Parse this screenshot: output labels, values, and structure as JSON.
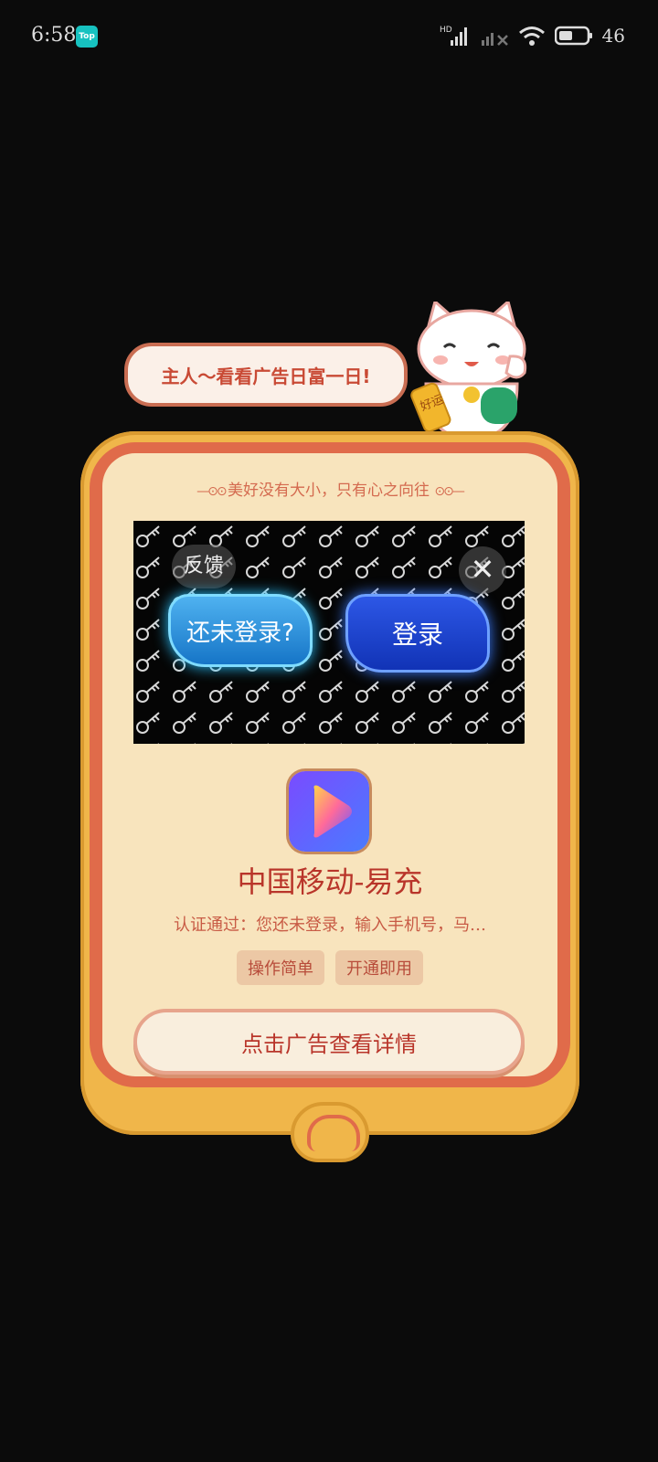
{
  "status_bar": {
    "time": "6:58",
    "app_badge": "Top",
    "network_label": "HD",
    "battery_percent": "46"
  },
  "mascot": {
    "speech": "主人～看看广告日富一日!",
    "sign_text": "好运"
  },
  "card": {
    "motto": "美好没有大小，只有心之向往",
    "ad": {
      "feedback_label": "反馈",
      "close_icon": "close-icon",
      "left_button": "还未登录?",
      "right_button": "登录"
    },
    "app_name": "中国移动-易充",
    "app_description": "认证通过：您还未登录，输入手机号，马…",
    "tags": [
      "操作简单",
      "开通即用"
    ],
    "cta_label": "点击广告查看详情"
  },
  "colors": {
    "background": "#0b0b0b",
    "frame_gold": "#f0b64a",
    "frame_red": "#e06b4a",
    "card_cream": "#f8e4bd",
    "accent_red": "#b9352a"
  }
}
